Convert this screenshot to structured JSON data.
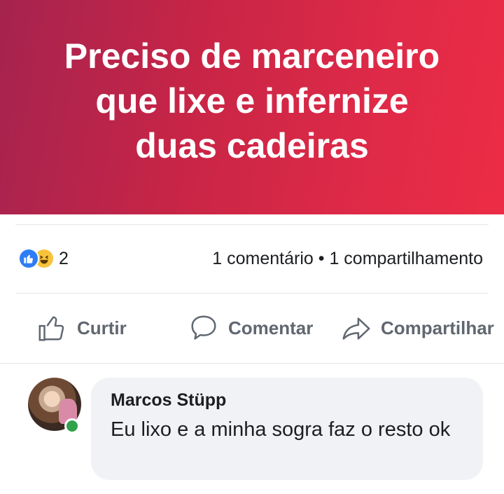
{
  "post": {
    "banner_lines": [
      "Preciso de marceneiro",
      "que lixe e infernize",
      "duas cadeiras"
    ],
    "banner_colors": {
      "start": "#a5234f",
      "end": "#ec2c44"
    }
  },
  "reactions": {
    "icons": [
      "like-icon",
      "haha-icon"
    ],
    "count": "2",
    "stats": "1 comentário • 1 compartilhamento"
  },
  "actions": {
    "like": {
      "label": "Curtir",
      "icon": "thumbs-up-icon"
    },
    "comment": {
      "label": "Comentar",
      "icon": "speech-bubble-icon"
    },
    "share": {
      "label": "Compartilhar",
      "icon": "share-arrow-icon"
    }
  },
  "comment": {
    "author": "Marcos Stüpp",
    "text": "Eu lixo e a minha sogra faz o resto ok",
    "online_color": "#31a24c"
  }
}
